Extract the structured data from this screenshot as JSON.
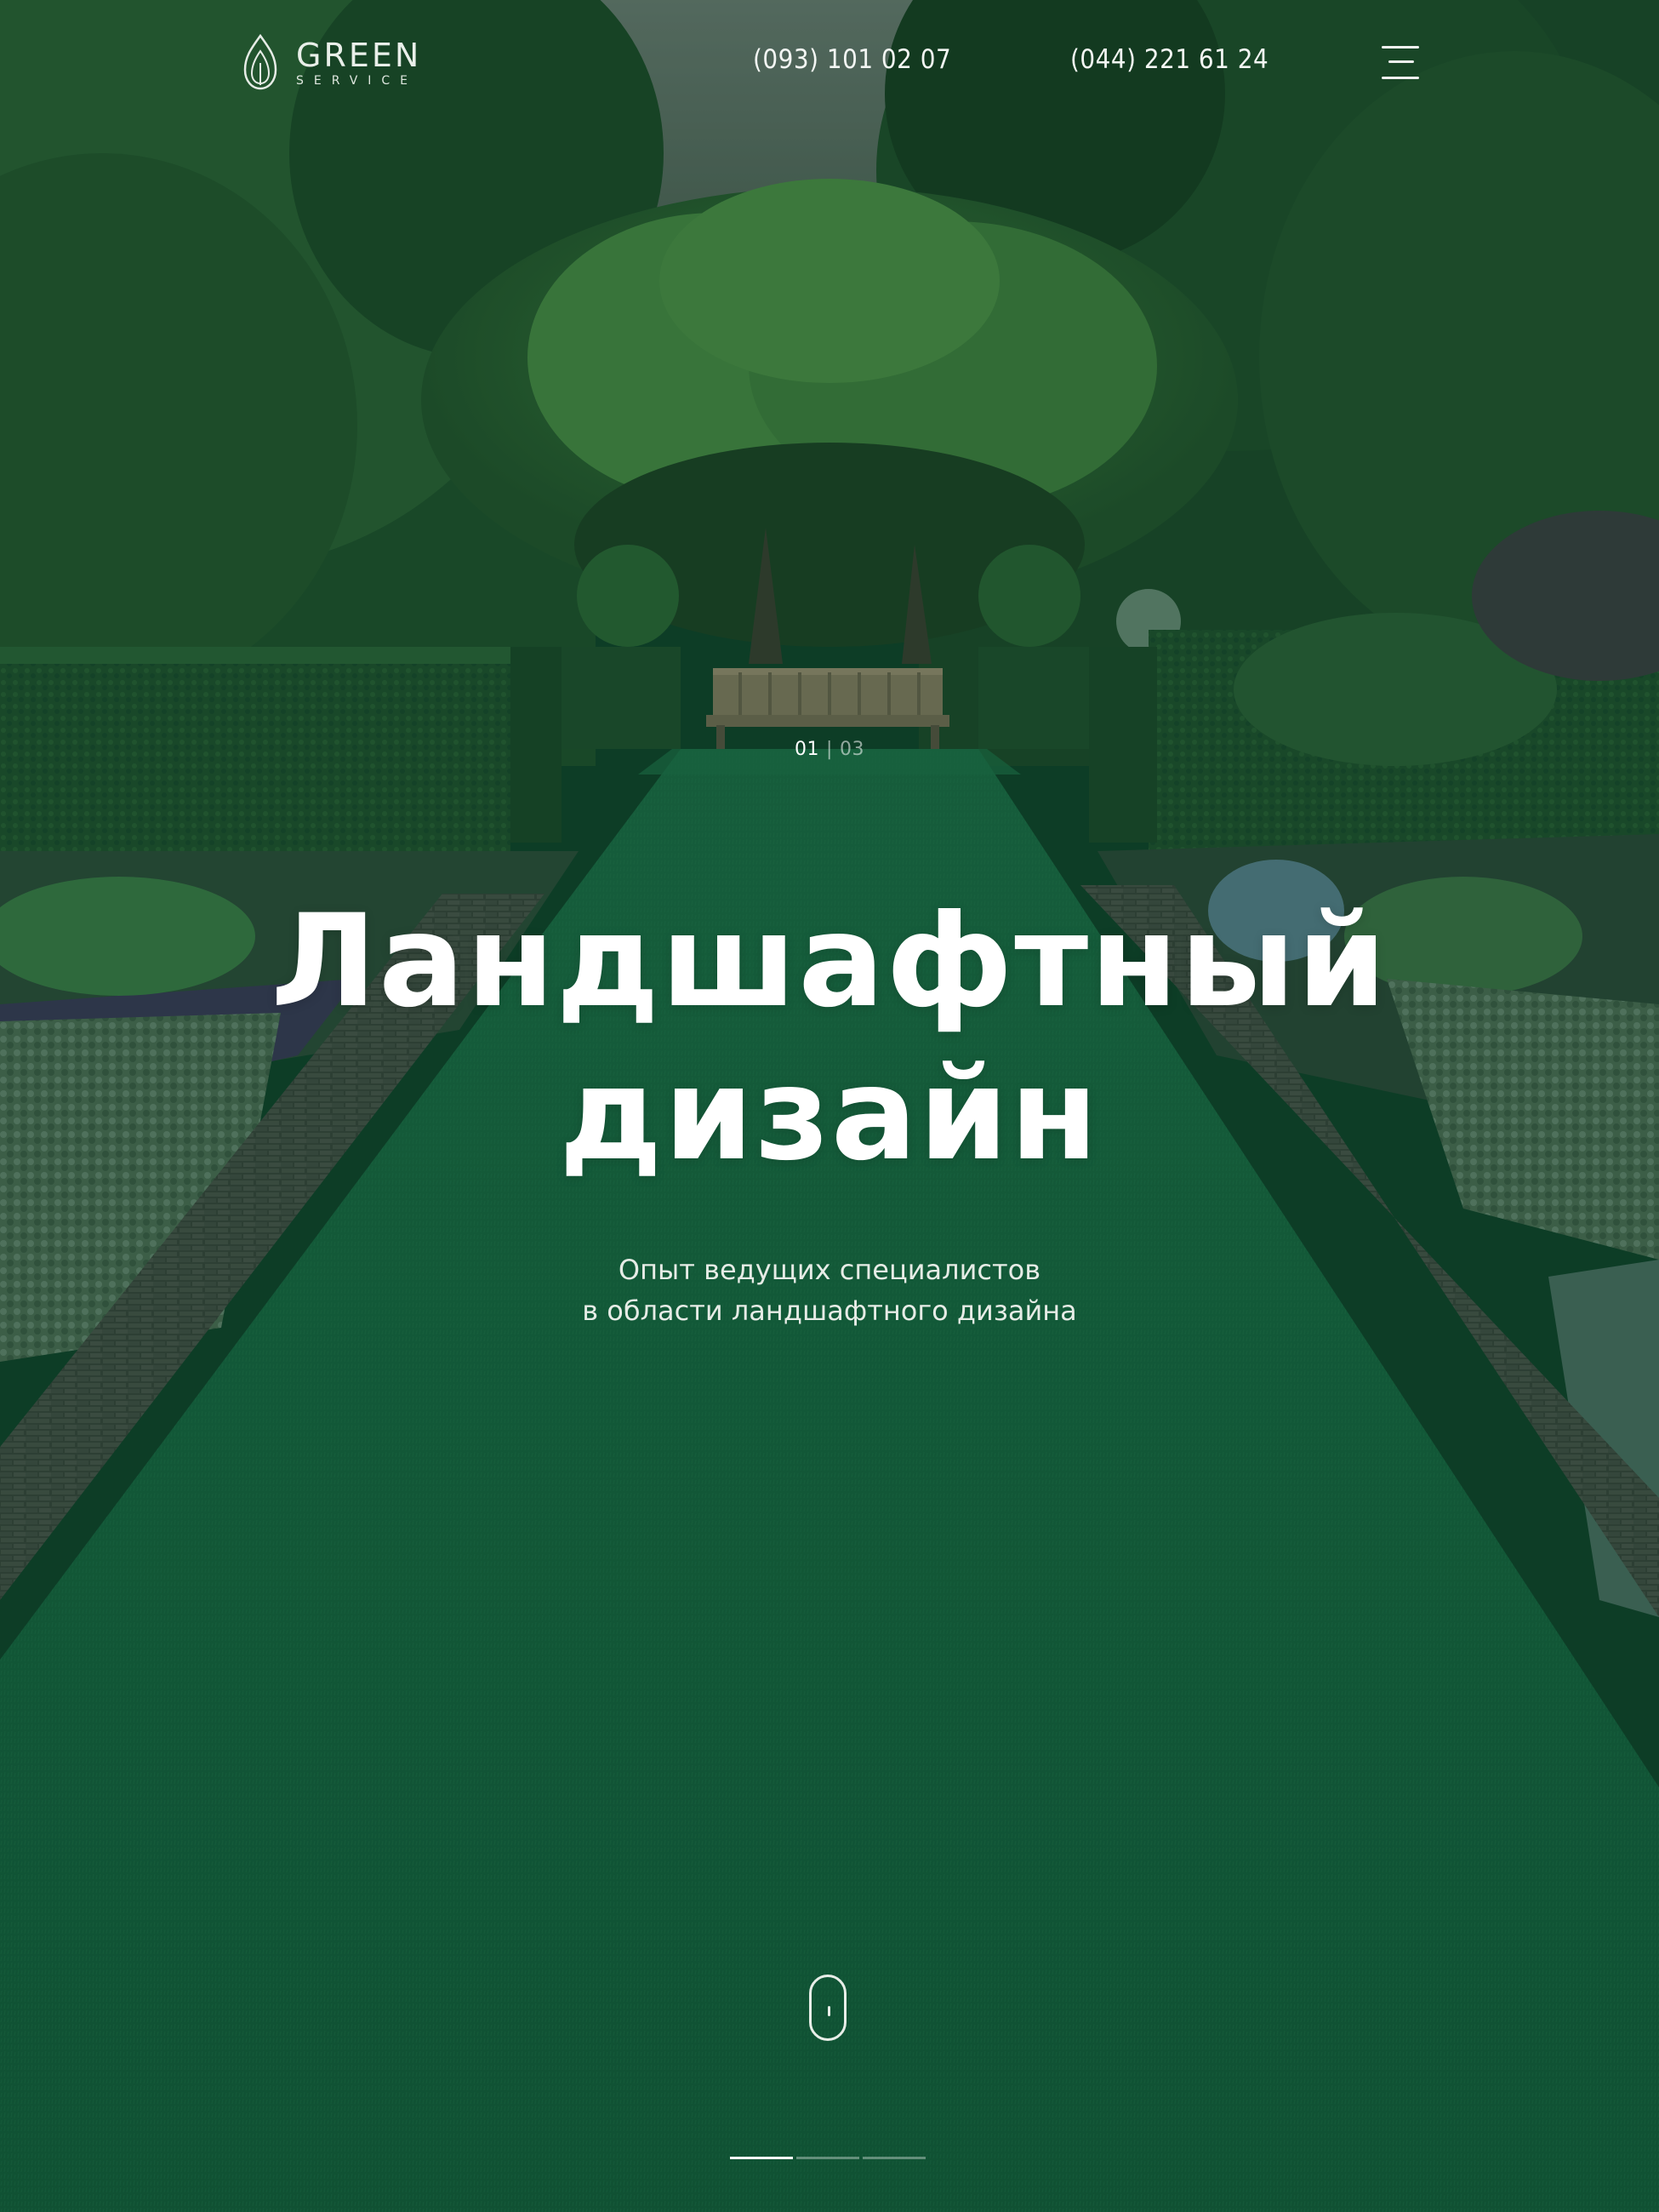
{
  "header": {
    "logo": {
      "word": "GREEN",
      "sub": "SERVICE",
      "icon": "leaf-drop-icon"
    },
    "phones": [
      "(093) 101 02 07",
      "(044) 221 61 24"
    ],
    "menu_icon": "hamburger-menu-icon"
  },
  "slider": {
    "current": "01",
    "separator": "|",
    "total": "03",
    "pages": [
      {
        "active": true
      },
      {
        "active": false
      },
      {
        "active": false
      }
    ]
  },
  "hero": {
    "title_line1": "Ландшафтный",
    "title_line2": "дизайн",
    "subtitle_line1": "Опыт ведущих специалистов",
    "subtitle_line2": "в области ландшафтного дизайна"
  },
  "scroll_indicator": {
    "icon": "mouse-scroll-icon"
  },
  "colors": {
    "overlay": "#0b4a2c",
    "lawn": "#1e6b44",
    "text": "#ffffff"
  }
}
